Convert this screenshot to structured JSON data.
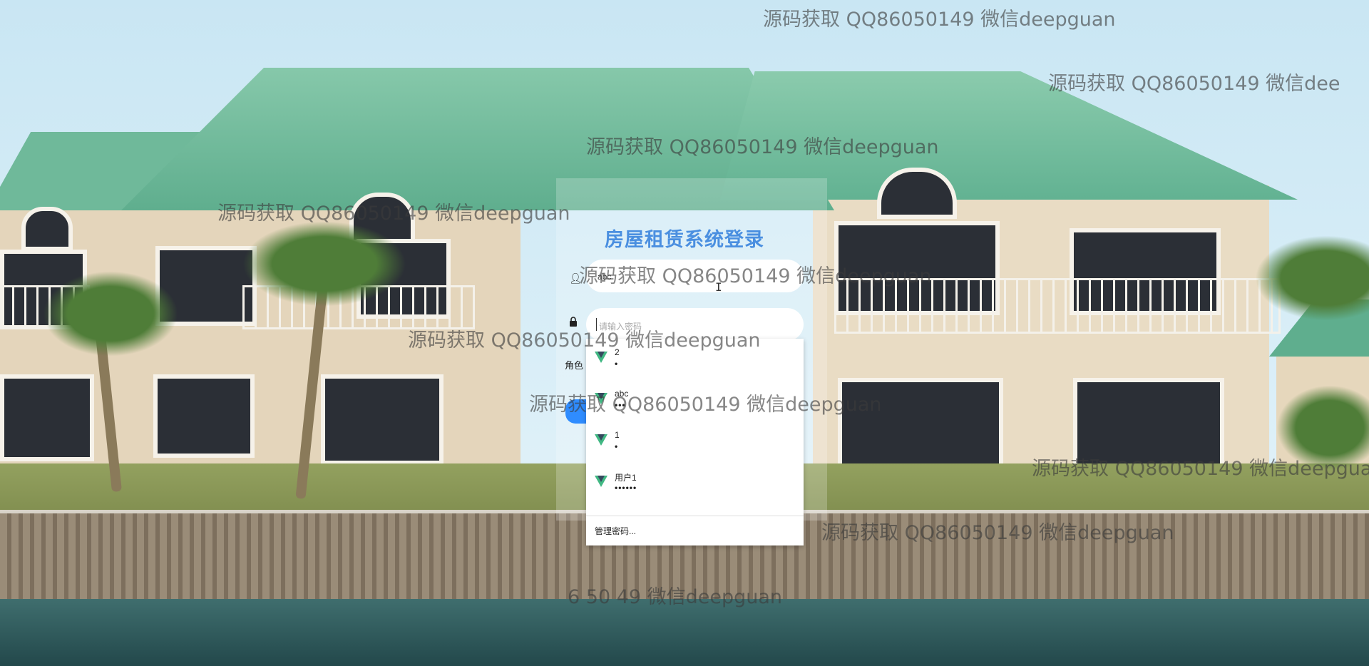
{
  "login": {
    "title": "房屋租赁系统登录",
    "username_value": "abc",
    "password_placeholder": "请输入密码",
    "role_label": "角色"
  },
  "autofill": {
    "items": [
      {
        "name": "2",
        "mask": "•"
      },
      {
        "name": "abc",
        "mask": "•••"
      },
      {
        "name": "1",
        "mask": "•"
      },
      {
        "name": "用户1",
        "mask": "••••••"
      }
    ],
    "manage_label": "管理密码..."
  },
  "watermark": "源码获取 QQ86050149 微信deepguan",
  "watermark_partial_top_right": "源码获取 QQ86050149 微信dee",
  "watermark_partial_bottom": "6 50 49 微信deepguan",
  "icons": {
    "user": "user-icon",
    "lock": "lock-icon",
    "credential": "vue-logo-icon"
  },
  "colors": {
    "title": "#4a8fe0",
    "button": "#2f8cff",
    "logo_green": "#41b883",
    "logo_dark": "#35495e"
  }
}
